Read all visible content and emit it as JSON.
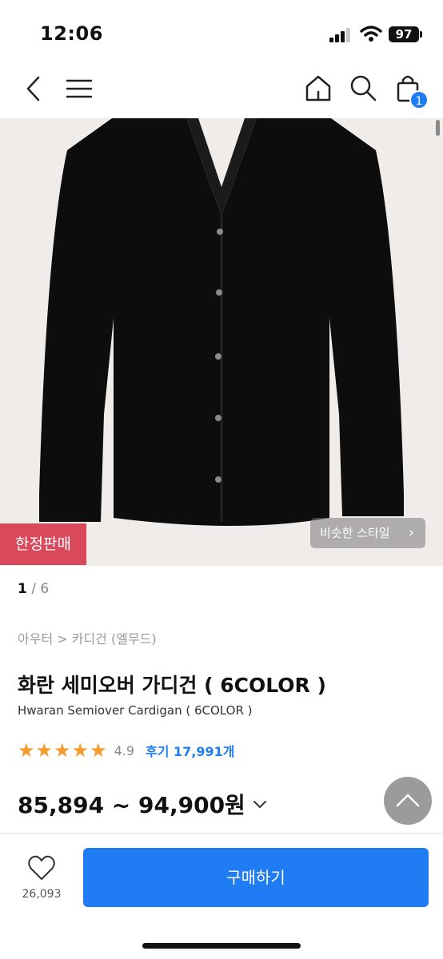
{
  "status": {
    "time": "12:06",
    "battery": "97"
  },
  "nav": {
    "cart_count": "1"
  },
  "image": {
    "badge": "한정판매",
    "similar_style": "비슷한 스타일",
    "pager_current": "1",
    "pager_sep": " / ",
    "pager_total": "6"
  },
  "product": {
    "breadcrumb": "아우터 > 카디건 (엘무드)",
    "title_ko": "화란 세미오버 가디건 ( 6COLOR )",
    "title_en": "Hwaran Semiover Cardigan ( 6COLOR )",
    "stars": "★★★★★",
    "rating": "4.9",
    "review_link": "후기 17,991개",
    "price": "85,894 ~ 94,900원"
  },
  "bottom": {
    "like_count": "26,093",
    "buy_label": "구매하기"
  },
  "colors": {
    "accent": "#1f7cf2",
    "badge": "#d9485b",
    "star": "#f39b2b"
  }
}
